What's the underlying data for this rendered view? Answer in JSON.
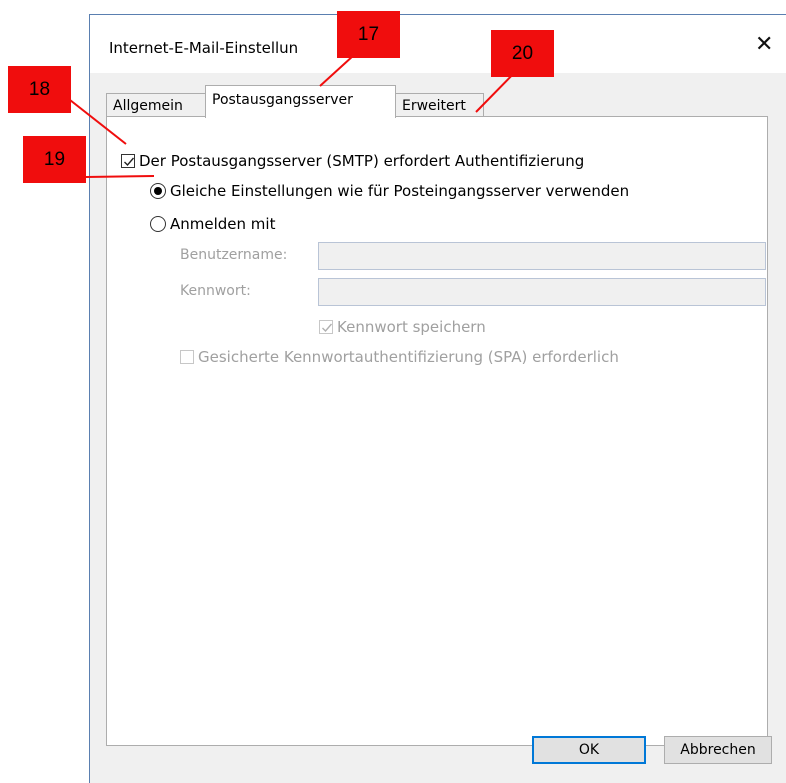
{
  "window": {
    "title": "Internet-E-Mail-Einstellun",
    "close_glyph": "✕"
  },
  "tabs": [
    {
      "label": "Allgemein",
      "active": false
    },
    {
      "label": "Postausgangsserver",
      "active": true
    },
    {
      "label": "Erweitert",
      "active": false
    }
  ],
  "auth": {
    "smtp_requires_auth_label": "Der Postausgangsserver (SMTP) erfordert Authentifizierung",
    "smtp_requires_auth_checked": true,
    "same_settings_label": "Gleiche Einstellungen wie für Posteingangsserver verwenden",
    "same_settings_selected": true,
    "login_with_label": "Anmelden mit",
    "login_with_selected": false
  },
  "credentials": {
    "username_label": "Benutzername:",
    "username_value": "",
    "password_label": "Kennwort:",
    "password_value": "",
    "save_password_label": "Kennwort speichern",
    "save_password_checked": true,
    "spa_label": "Gesicherte Kennwortauthentifizierung (SPA) erforderlich",
    "spa_checked": false
  },
  "buttons": {
    "ok_label": "OK",
    "cancel_label": "Abbrechen"
  },
  "markers": {
    "m17": "17",
    "m18": "18",
    "m19": "19",
    "m20": "20",
    "color": "#f00d0d"
  }
}
